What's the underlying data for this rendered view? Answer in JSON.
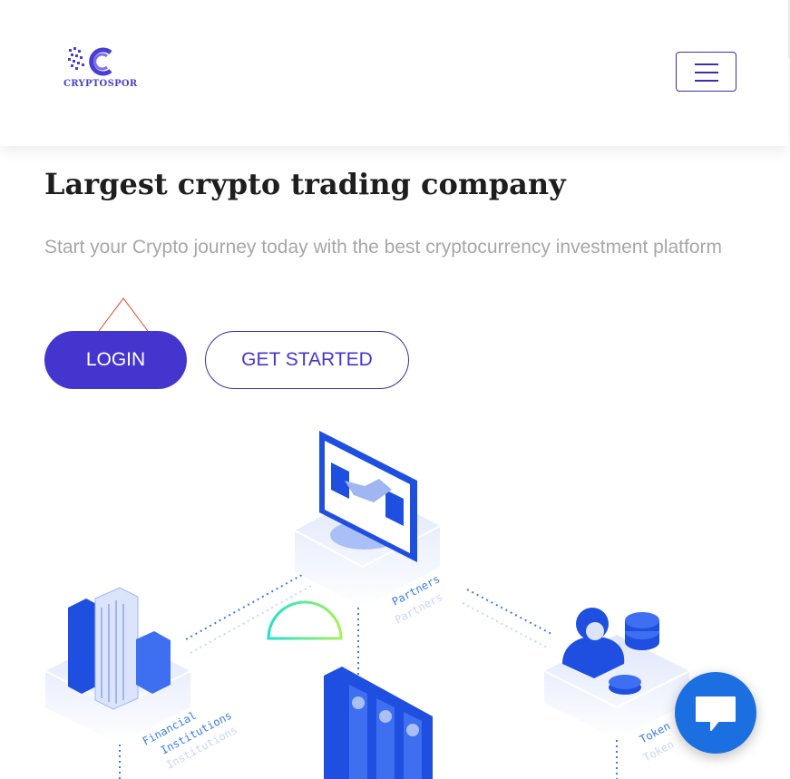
{
  "header": {
    "logo_text": "CRYPTOSPOR",
    "menu_icon": "hamburger-icon"
  },
  "hero": {
    "title": "Largest crypto trading company",
    "subtitle": "Start your Crypto journey today with the best cryptocurrency investment platform",
    "login_label": "LOGIN",
    "get_started_label": "GET STARTED"
  },
  "illustration": {
    "partners_label": "Partners",
    "financial_label": "Financial",
    "institutions_label": "Institutions",
    "token_label": "Token"
  },
  "chat": {
    "icon": "chat-bubble-icon"
  },
  "colors": {
    "primary": "#4535cf",
    "accent_blue": "#1c6fe0",
    "title": "#1e1e1e",
    "subtitle": "#a7a7a7"
  }
}
